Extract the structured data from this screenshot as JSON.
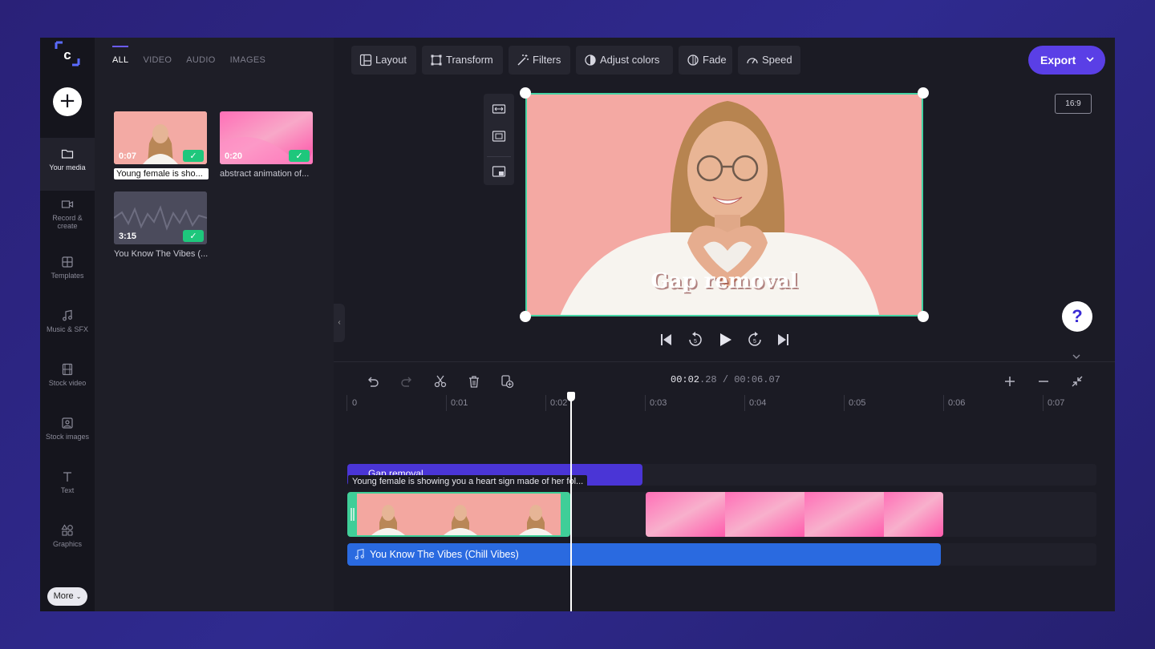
{
  "rail": {
    "items": [
      {
        "label": "Your media",
        "icon": "folder-icon"
      },
      {
        "label": "Record & create",
        "icon": "camera-icon"
      },
      {
        "label": "Templates",
        "icon": "templates-icon"
      },
      {
        "label": "Music & SFX",
        "icon": "music-icon"
      },
      {
        "label": "Stock video",
        "icon": "film-icon"
      },
      {
        "label": "Stock images",
        "icon": "image-icon"
      },
      {
        "label": "Text",
        "icon": "text-icon"
      },
      {
        "label": "Graphics",
        "icon": "shapes-icon"
      }
    ],
    "more_label": "More"
  },
  "media": {
    "tabs": [
      "ALL",
      "VIDEO",
      "AUDIO",
      "IMAGES"
    ],
    "items": [
      {
        "duration": "0:07",
        "label": "Young female is sho..."
      },
      {
        "duration": "0:20",
        "label": "abstract animation of..."
      },
      {
        "duration": "3:15",
        "label": "You Know The Vibes (..."
      }
    ]
  },
  "toolbar": {
    "layout": "Layout",
    "transform": "Transform",
    "filters": "Filters",
    "adjust_colors": "Adjust colors",
    "fade": "Fade",
    "speed": "Speed",
    "export": "Export"
  },
  "preview": {
    "aspect_ratio": "16:9",
    "caption": "Gap removal",
    "help": "?"
  },
  "timeline": {
    "current_main": "00:02",
    "current_frac": ".28",
    "separator": " / ",
    "total_main": "00:06",
    "total_frac": ".07",
    "ticks": [
      "0",
      "0:01",
      "0:02",
      "0:03",
      "0:04",
      "0:05",
      "0:06",
      "0:07"
    ],
    "text_clip": "Gap removal",
    "tooltip": "Young female is showing you a heart sign made of her fol...",
    "audio_clip": "You Know The Vibes (Chill Vibes)"
  },
  "colors": {
    "accent": "#5a3fe6",
    "selection": "#46d3a4",
    "audio": "#2a6ae0",
    "text_track": "#4a35d6"
  }
}
